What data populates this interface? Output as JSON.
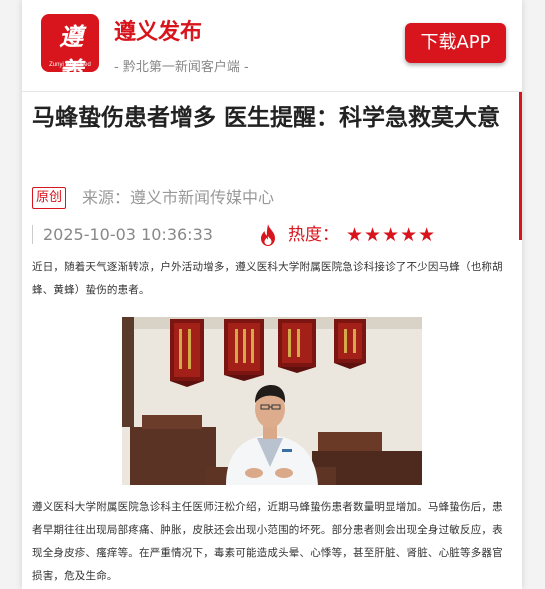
{
  "header": {
    "logo_text": "遵義",
    "logo_en": "Zunyi Released",
    "title": "遵义发布",
    "subtitle": "- 黔北第一新闻客户端 -",
    "download_label": "下载APP"
  },
  "article": {
    "headline": "马蜂蛰伤患者增多 医生提醒：科学急救莫大意",
    "badge": "原创",
    "source": "来源：遵义市新闻传媒中心",
    "date": "2025-10-03 10:36:33",
    "heat_label": "热度：",
    "heat_rating": 5,
    "stars": "★★★★★",
    "paragraph1": "近日，随着天气逐渐转凉，户外活动增多，遵义医科大学附属医院急诊科接诊了不少因马蜂（也称胡蜂、黄蜂）蛰伤的患者。",
    "paragraph2": "遵义医科大学附属医院急诊科主任医师汪松介绍，近期马蜂蛰伤患者数量明显增加。马蜂蛰伤后，患者早期往往出现局部疼痛、肿胀，皮肤还会出现小范围的坏死。部分患者则会出现全身过敏反应，表现全身皮疹、瘙痒等。在严重情况下，毒素可能造成头晕、心悸等，甚至肝脏、肾脏、心脏等多器官损害，危及生命。"
  },
  "colors": {
    "brand_red": "#d8141c",
    "text_dark": "#222222",
    "text_gray": "#888888"
  },
  "icons": {
    "fire": "fire-icon",
    "logo": "zunyi-logo-icon"
  }
}
